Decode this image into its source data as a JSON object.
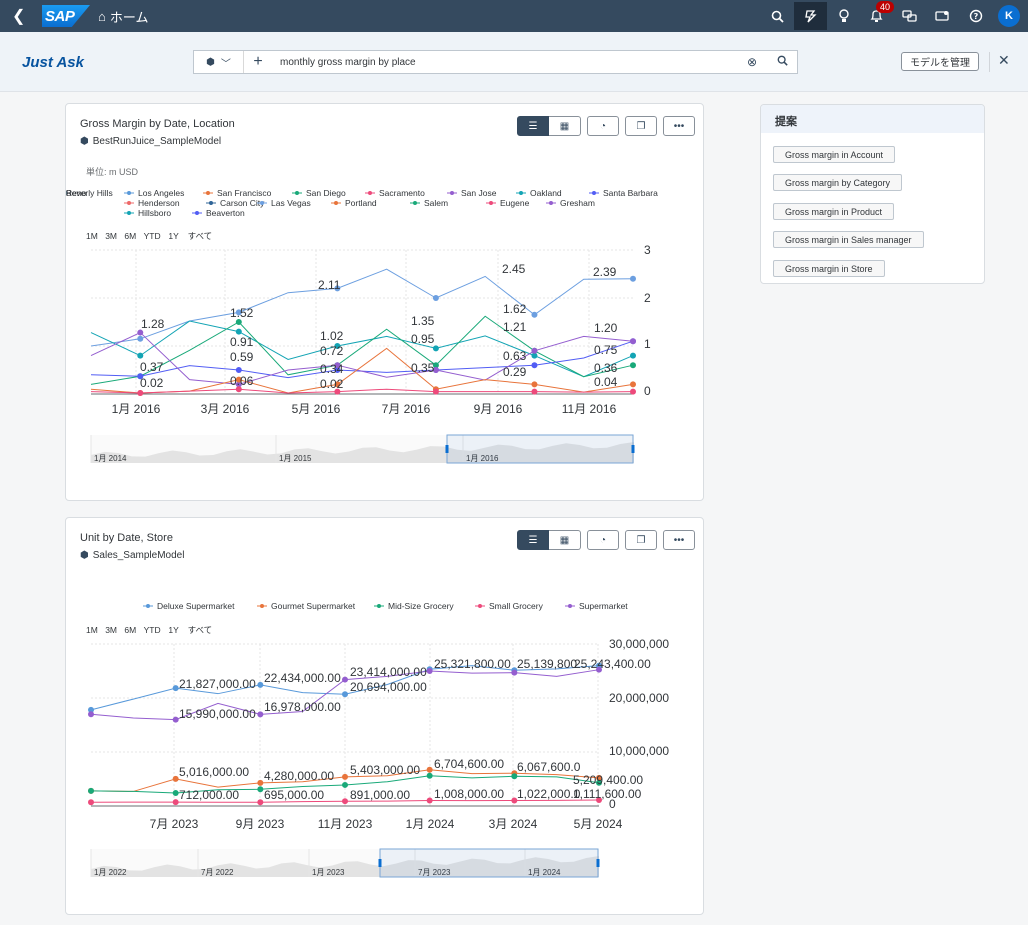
{
  "shell": {
    "home_label": "ホーム",
    "notification_count": "40",
    "avatar_initial": "K",
    "logo_text": "SAP"
  },
  "header": {
    "title": "Just Ask",
    "query": "monthly gross margin by place",
    "manage_label": "モデルを管理"
  },
  "suggestions": {
    "title": "提案",
    "items": [
      "Gross margin in Account",
      "Gross margin by Category",
      "Gross margin in Product",
      "Gross margin in Sales manager",
      "Gross margin in Store"
    ]
  },
  "card1": {
    "title": "Gross Margin by Date, Location",
    "model": "BestRunJuice_SampleModel"
  },
  "card2": {
    "title": "Unit by Date, Store",
    "model": "Sales_SampleModel"
  },
  "colors": {
    "accent": "#0a6ed1",
    "shell": "#354a5f"
  },
  "chart_data": [
    {
      "type": "line",
      "unit_label": "単位: m USD",
      "legend": [
        "Los Angeles",
        "San Francisco",
        "San Diego",
        "Sacramento",
        "San Jose",
        "Oakland",
        "Santa Barbara",
        "Beverly Hills",
        "Reno",
        "Henderson",
        "Carson City",
        "Las Vegas",
        "Portland",
        "Salem",
        "Eugene",
        "Gresham",
        "Hillsboro",
        "Beaverton"
      ],
      "legend_colors": [
        "#5899da",
        "#e8743b",
        "#19a979",
        "#ed4a7b",
        "#945ecf",
        "#13a4b4",
        "#525df4",
        "#bf399e",
        "#6c8893",
        "#ee6868",
        "#2f6497",
        "#6c9fe0",
        "#e8743b",
        "#19a979",
        "#ed4a7b",
        "#945ecf",
        "#13a4b4",
        "#525df4"
      ],
      "range_buttons": [
        "1M",
        "3M",
        "6M",
        "YTD",
        "1Y",
        "すべて"
      ],
      "x_ticks": [
        "1月 2016",
        "3月 2016",
        "5月 2016",
        "7月 2016",
        "9月 2016",
        "11月 2016"
      ],
      "y_ticks": [
        "3",
        "2",
        "1",
        "0"
      ],
      "ylim": [
        0,
        3
      ],
      "data_labels": [
        "1.28",
        "1.52",
        "2.11",
        "2.45",
        "2.39",
        "0.37",
        "0.02",
        "0.91",
        "0.59",
        "0.06",
        "1.02",
        "0.72",
        "0.34",
        "0.02",
        "1.35",
        "0.95",
        "0.35",
        "1.62",
        "1.21",
        "0.63",
        "0.29",
        "1.20",
        "0.75",
        "0.36",
        "0.04"
      ],
      "navigator_labels": [
        "1月 2014",
        "1月 2015",
        "1月 2016"
      ],
      "series": [
        {
          "name": "Las Vegas",
          "values": [
            1.0,
            1.15,
            1.52,
            1.7,
            2.11,
            2.2,
            2.6,
            2.0,
            2.45,
            1.65,
            2.39,
            2.4
          ]
        },
        {
          "name": "Oakland",
          "values": [
            1.28,
            0.8,
            1.52,
            1.3,
            0.72,
            1.0,
            1.2,
            0.95,
            1.21,
            0.8,
            0.36,
            0.8
          ]
        },
        {
          "name": "San Diego",
          "values": [
            0.2,
            0.37,
            0.91,
            1.5,
            0.4,
            0.6,
            1.35,
            0.6,
            1.62,
            0.9,
            0.36,
            0.6
          ]
        },
        {
          "name": "Santa Barbara",
          "values": [
            0.4,
            0.37,
            0.59,
            0.5,
            0.34,
            0.5,
            0.45,
            0.5,
            0.55,
            0.6,
            0.75,
            1.1
          ]
        },
        {
          "name": "San Jose",
          "values": [
            0.8,
            1.28,
            0.3,
            0.2,
            0.5,
            0.6,
            0.35,
            0.5,
            0.29,
            0.9,
            1.2,
            1.1
          ]
        },
        {
          "name": "San Francisco",
          "values": [
            0.1,
            0.02,
            0.06,
            0.3,
            0.02,
            0.2,
            0.95,
            0.1,
            0.3,
            0.2,
            0.04,
            0.2
          ]
        },
        {
          "name": "Sacramento",
          "values": [
            0.05,
            0.02,
            0.06,
            0.1,
            0.02,
            0.05,
            0.1,
            0.05,
            0.05,
            0.05,
            0.04,
            0.05
          ]
        }
      ]
    },
    {
      "type": "line",
      "legend": [
        "Deluxe Supermarket",
        "Gourmet Supermarket",
        "Mid-Size Grocery",
        "Small Grocery",
        "Supermarket"
      ],
      "legend_colors": [
        "#5899da",
        "#e8743b",
        "#19a979",
        "#ed4a7b",
        "#945ecf"
      ],
      "range_buttons": [
        "1M",
        "3M",
        "6M",
        "YTD",
        "1Y",
        "すべて"
      ],
      "x_ticks": [
        "7月 2023",
        "9月 2023",
        "11月 2023",
        "1月 2024",
        "3月 2024",
        "5月 2024"
      ],
      "y_ticks": [
        "30,000,000",
        "20,000,000",
        "10,000,000",
        "0"
      ],
      "ylim": [
        0,
        30000000
      ],
      "data_labels": [
        "21,827,000.00",
        "22,434,000.00",
        "23,414,000.00",
        "25,321,800.00",
        "25,139,800",
        "25,243,400.00",
        "15,990,000.00",
        "16,978,000.00",
        "20,694,000.00",
        "5,016,000.00",
        "4,280,000.00",
        "5,403,000.00",
        "6,704,600.00",
        "6,067,600.0",
        "5,209,400.00",
        "712,000.00",
        "695,000.00",
        "891,000.00",
        "1,008,000.00",
        "1,022,000.0",
        "1,111,600.00"
      ],
      "navigator_labels": [
        "1月 2022",
        "7月 2022",
        "1月 2023",
        "7月 2023",
        "1月 2024"
      ],
      "series": [
        {
          "name": "Deluxe Supermarket",
          "values": [
            17800000,
            19800000,
            21827000,
            20800000,
            22434000,
            21000000,
            20694000,
            22500000,
            25321800,
            26000000,
            25139800,
            25400000,
            26000000
          ]
        },
        {
          "name": "Supermarket",
          "values": [
            17000000,
            16300000,
            15990000,
            19000000,
            16978000,
            17500000,
            23414000,
            24000000,
            25000000,
            24600000,
            24700000,
            24000000,
            25243400
          ]
        },
        {
          "name": "Gourmet Supermarket",
          "values": [
            2800000,
            2700000,
            5016000,
            3500000,
            4280000,
            4500000,
            5403000,
            5600000,
            6704600,
            6000000,
            6067600,
            5800000,
            5209400
          ]
        },
        {
          "name": "Mid-Size Grocery",
          "values": [
            2800000,
            2700000,
            2400000,
            3000000,
            3100000,
            3600000,
            3900000,
            4500000,
            5600000,
            5200000,
            5500000,
            5400000,
            4300000
          ]
        },
        {
          "name": "Small Grocery",
          "values": [
            700000,
            712000,
            712000,
            700000,
            695000,
            800000,
            891000,
            900000,
            1008000,
            1000000,
            1022000,
            1050000,
            1111600
          ]
        }
      ]
    }
  ]
}
